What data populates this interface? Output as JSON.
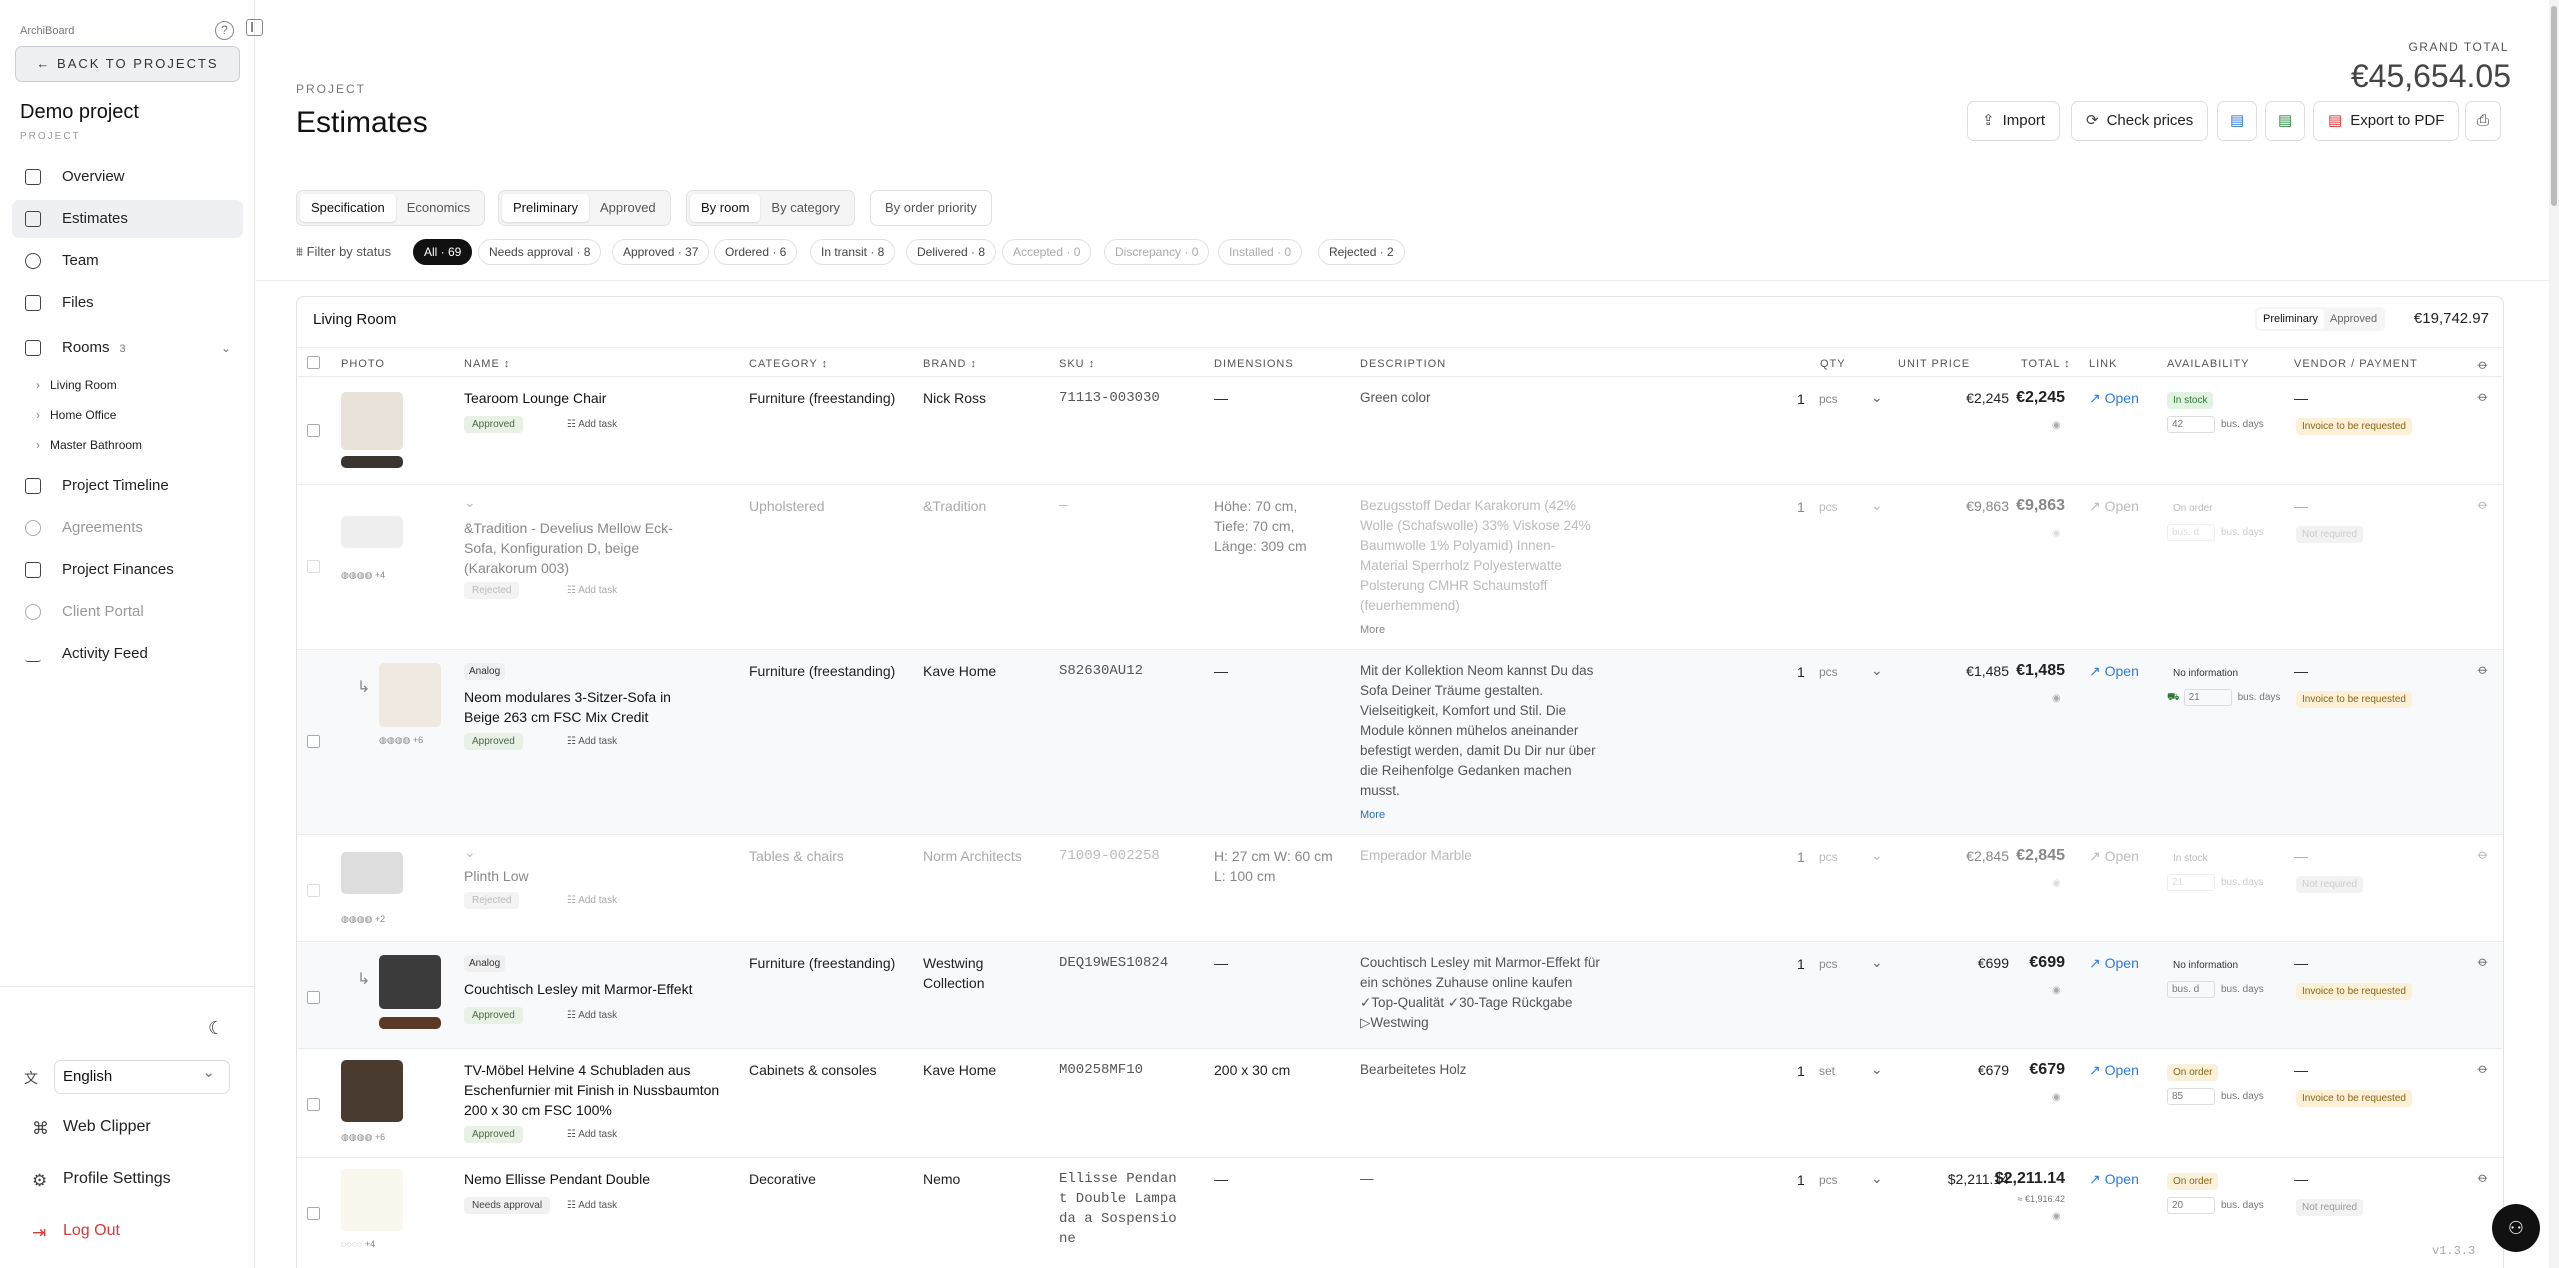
{
  "sidebar": {
    "brand": "ArchiBoard",
    "back": "← BACK TO PROJECTS",
    "project_name": "Demo project",
    "project_label": "PROJECT",
    "nav": {
      "overview": "Overview",
      "estimates": "Estimates",
      "team": "Team",
      "files": "Files",
      "rooms": "Rooms",
      "rooms_count": "3",
      "timeline": "Project Timeline",
      "agreements": "Agreements",
      "finances": "Project Finances",
      "portal": "Client Portal",
      "activity": "Activity Feed"
    },
    "rooms": [
      "Living Room",
      "Home Office",
      "Master Bathroom"
    ],
    "language": "English",
    "web_clipper": "Web Clipper",
    "profile": "Profile Settings",
    "logout": "Log Out"
  },
  "header": {
    "overline": "PROJECT",
    "title": "Estimates",
    "grand_total_label": "GRAND TOTAL",
    "grand_total": "€45,654.05",
    "import": "Import",
    "check_prices": "Check prices",
    "export_pdf": "Export to PDF"
  },
  "segments": {
    "view": [
      "Specification",
      "Economics"
    ],
    "stage": [
      "Preliminary",
      "Approved"
    ],
    "group": [
      "By room",
      "By category"
    ],
    "priority": "By order priority"
  },
  "filters": {
    "label": "Filter by status",
    "chips": [
      "All · 69",
      "Needs approval · 8",
      "Approved · 37",
      "Ordered · 6",
      "In transit · 8",
      "Delivered · 8",
      "Accepted · 0",
      "Discrepancy · 0",
      "Installed · 0",
      "Rejected · 2"
    ]
  },
  "room": {
    "name": "Living Room",
    "seg": [
      "Preliminary",
      "Approved"
    ],
    "total": "€19,742.97"
  },
  "columns": {
    "photo": "PHOTO",
    "name": "NAME ↕",
    "category": "CATEGORY ↕",
    "brand": "BRAND ↕",
    "sku": "SKU ↕",
    "dimensions": "DIMENSIONS",
    "description": "DESCRIPTION",
    "qty": "QTY",
    "unit_price": "UNIT PRICE",
    "total": "TOTAL ↕",
    "link": "LINK",
    "availability": "AVAILABILITY",
    "vendor": "VENDOR / PAYMENT"
  },
  "rows": [
    {
      "name": "Tearoom Lounge Chair",
      "badge": "Approved",
      "category": "Furniture (freestanding)",
      "brand": "Nick Ross",
      "sku": "71113-003030",
      "dims": "—",
      "desc": "Green color",
      "qty": "1",
      "unit": "pcs",
      "unit_price": "€2,245",
      "total": "€2,245",
      "link": "Open",
      "avail": "In stock",
      "days": "42",
      "vendor_dash": "—",
      "vendor": "Invoice to be requested"
    },
    {
      "name": "&Tradition - Develius Mellow Eck-Sofa, Konfiguration D, beige (Karakorum 003)",
      "badge": "Rejected",
      "category": "Upholstered",
      "brand": "&Tradition",
      "sku": "—",
      "dims": "Höhe: 70 cm, Tiefe: 70 cm, Länge: 309 cm",
      "desc": "Bezugsstoff Dedar Karakorum (42% Wolle (Schafswolle) 33% Viskose 24% Baumwolle 1% Polyamid) Innen-Material Sperrholz Polyesterwatte Polsterung CMHR Schaumstoff (feuerhemmend)",
      "more": "More",
      "qty": "1",
      "unit": "pcs",
      "unit_price": "€9,863",
      "total": "€9,863",
      "link": "Open",
      "avail": "On order",
      "days": "bus. d",
      "vendor_dash": "—",
      "vendor": "Not required"
    },
    {
      "name": "Neom modulares 3-Sitzer-Sofa in Beige 263 cm FSC Mix Credit",
      "analog": "Analog",
      "badge": "Approved",
      "category": "Furniture (freestanding)",
      "brand": "Kave Home",
      "sku": "S82630AU12",
      "dims": "—",
      "desc": "Mit der Kollektion Neom kannst Du das Sofa Deiner Träume gestalten. Vielseitigkeit, Komfort und Stil. Die Module können mühelos aneinander befestigt werden, damit Du Dir nur über die Reihenfolge Gedanken machen musst.",
      "more": "More",
      "qty": "1",
      "unit": "pcs",
      "unit_price": "€1,485",
      "total": "€1,485",
      "link": "Open",
      "avail": "No information",
      "days": "21",
      "vendor_dash": "—",
      "vendor": "Invoice to be requested"
    },
    {
      "name": "Plinth Low",
      "badge": "Rejected",
      "category": "Tables & chairs",
      "brand": "Norm Architects",
      "sku": "71009-002258",
      "dims": "H: 27 cm W: 60 cm L: 100 cm",
      "desc": "Emperador Marble",
      "qty": "1",
      "unit": "pcs",
      "unit_price": "€2,845",
      "total": "€2,845",
      "link": "Open",
      "avail": "In stock",
      "days": "21",
      "vendor_dash": "—",
      "vendor": "Not required"
    },
    {
      "name": "Couchtisch Lesley mit Marmor-Effekt",
      "analog": "Analog",
      "badge": "Approved",
      "category": "Furniture (freestanding)",
      "brand": "Westwing Collection",
      "sku": "DEQ19WES10824",
      "dims": "—",
      "desc": "Couchtisch Lesley mit Marmor-Effekt für ein schönes Zuhause online kaufen ✓Top-Qualität ✓30-Tage Rückgabe ▷Westwing",
      "qty": "1",
      "unit": "pcs",
      "unit_price": "€699",
      "total": "€699",
      "link": "Open",
      "avail": "No information",
      "days": "bus. d",
      "vendor_dash": "—",
      "vendor": "Invoice to be requested"
    },
    {
      "name": "TV-Möbel Helvine 4 Schubladen aus Eschenfurnier mit Finish in Nussbaumton 200 x 30 cm FSC 100%",
      "badge": "Approved",
      "category": "Cabinets & consoles",
      "brand": "Kave Home",
      "sku": "M00258MF10",
      "dims": "200 x 30 cm",
      "desc": "Bearbeitetes Holz",
      "qty": "1",
      "unit": "set",
      "unit_price": "€679",
      "total": "€679",
      "link": "Open",
      "avail": "On order",
      "days": "85",
      "vendor_dash": "—",
      "vendor": "Invoice to be requested"
    },
    {
      "name": "Nemo Ellisse Pendant Double",
      "badge": "Needs approval",
      "category": "Decorative",
      "brand": "Nemo",
      "sku": "Ellisse Pendant Double Lampada a Sospensione",
      "dims": "—",
      "desc": "—",
      "qty": "1",
      "unit": "pcs",
      "unit_price": "$2,211.14",
      "total": "$2,211.14",
      "total_sub": "≈ €1,916.42",
      "link": "Open",
      "avail": "On order",
      "days": "20",
      "vendor_dash": "—",
      "vendor": "Not required"
    }
  ],
  "add_task": "Add task",
  "bus_days": "bus. days",
  "version": "v1.3.3",
  "icons": [
    "help-icon",
    "sidebar-collapse-icon",
    "grid-icon",
    "document-icon",
    "users-icon",
    "folder-icon",
    "home-icon",
    "timeline-icon",
    "link-icon",
    "chart-icon",
    "activity-icon",
    "moon-icon",
    "translate-icon",
    "clipper-icon",
    "gear-icon",
    "logout-icon",
    "upload-icon",
    "refresh-icon",
    "sheet-icon",
    "pdf-icon",
    "printer-icon",
    "filter-icon",
    "paperclip-icon",
    "eye-icon",
    "external-link-icon",
    "robot-icon"
  ]
}
